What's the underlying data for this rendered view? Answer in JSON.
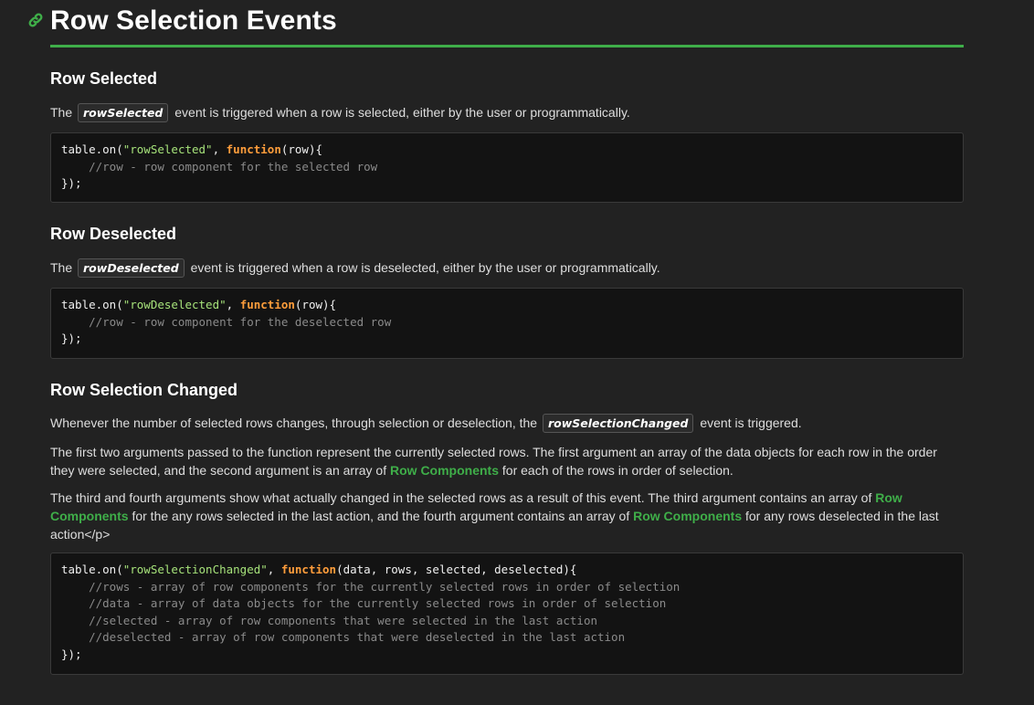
{
  "heading": "Row Selection Events",
  "sections": [
    {
      "title": "Row Selected",
      "text_before": "The",
      "event": "rowSelected",
      "text_after": "event is triggered when a row is selected, either by the user or programmatically.",
      "code": {
        "line1_pre": "table.on(",
        "line1_str": "\"rowSelected\"",
        "line1_mid": ", ",
        "line1_kw": "function",
        "line1_post": "(row){",
        "comment": "    //row - row component for the selected row",
        "close": "});"
      }
    },
    {
      "title": "Row Deselected",
      "text_before": "The",
      "event": "rowDeselected",
      "text_after": "event is triggered when a row is deselected, either by the user or programmatically.",
      "code": {
        "line1_pre": "table.on(",
        "line1_str": "\"rowDeselected\"",
        "line1_mid": ", ",
        "line1_kw": "function",
        "line1_post": "(row){",
        "comment": "    //row - row component for the deselected row",
        "close": "});"
      }
    },
    {
      "title": "Row Selection Changed",
      "p1_before": "Whenever the number of selected rows changes, through selection or deselection, the",
      "event": "rowSelectionChanged",
      "p1_after": "event is triggered.",
      "p2_before": "The first two arguments passed to the function represent the currently selected rows. The first argument an array of the data objects for each row in the order they were selected, and the second argument is an array of",
      "p2_link": "Row Components",
      "p2_after": "for each of the rows in order of selection.",
      "p3_a": "The third and fourth arguments show what actually changed in the selected rows as a result of this event. The third argument contains an array of",
      "p3_link1": "Row Components",
      "p3_b": "for the any rows selected in the last action, and the fourth argument contains an array of",
      "p3_link2": "Row Components",
      "p3_c": "for any rows deselected in the last action</p>",
      "code": {
        "line1_pre": "table.on(",
        "line1_str": "\"rowSelectionChanged\"",
        "line1_mid": ", ",
        "line1_kw": "function",
        "line1_post": "(data, rows, selected, deselected){",
        "comments": [
          "    //rows - array of row components for the currently selected rows in order of selection",
          "    //data - array of data objects for the currently selected rows in order of selection",
          "    //selected - array of row components that were selected in the last action",
          "    //deselected - array of row components that were deselected in the last action"
        ],
        "close": "});"
      }
    }
  ],
  "colors": {
    "accent": "#3fae49",
    "background": "#222222",
    "code_background": "#131313",
    "string": "#a6e27a",
    "keyword": "#ff9d3b",
    "comment": "#8a8a8a"
  },
  "icons": {
    "anchor": "link-icon"
  }
}
